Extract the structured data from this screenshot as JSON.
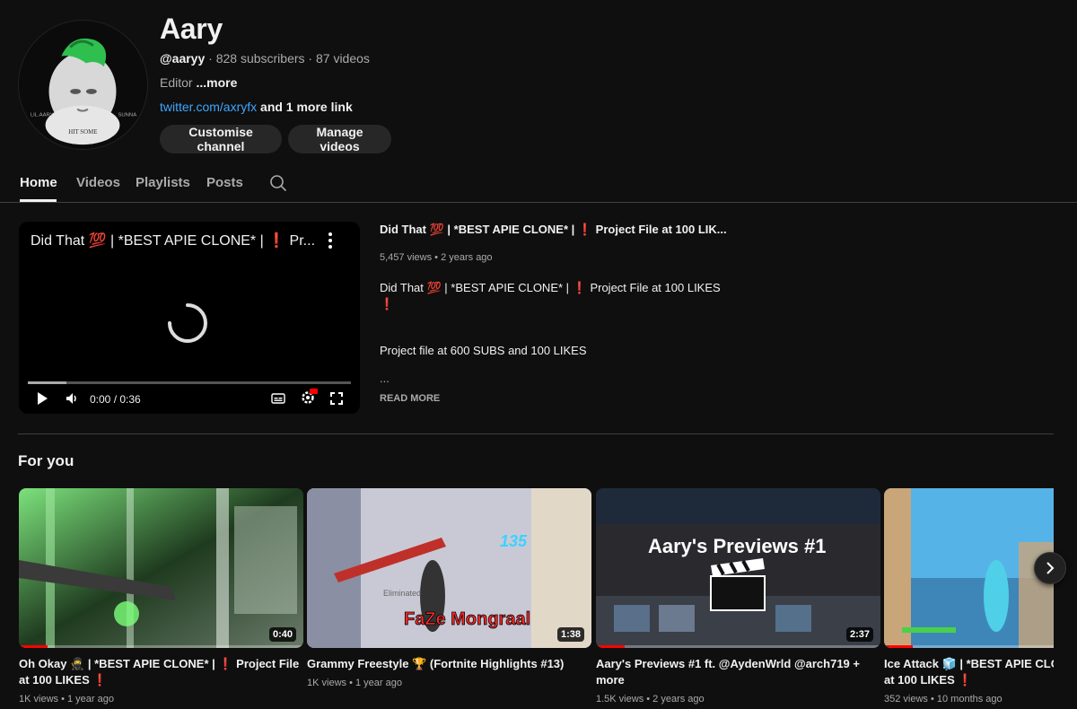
{
  "channel": {
    "name": "Aary",
    "handle": "@aaryy",
    "sep1": " · ",
    "subscribers": "828 subscribers",
    "sep2": " · ",
    "videos": "87 videos",
    "description": "Editor ",
    "more_label": "...more",
    "link_text": "twitter.com/axryfx",
    "more_links": " and 1 more link",
    "avatar_text_left": "LIL.AARY",
    "avatar_text_right": "SUNNA",
    "avatar_caption": "HIT SOME"
  },
  "buttons": {
    "customise": "Customise channel",
    "manage": "Manage videos"
  },
  "tabs": [
    "Home",
    "Videos",
    "Playlists",
    "Posts"
  ],
  "player": {
    "title": "Did That 💯 | *BEST APIE CLONE* | ❗ Pr...",
    "time": "0:00 / 0:36",
    "buffered_fraction": 0.12
  },
  "featured": {
    "title": "Did That 💯 | *BEST APIE CLONE* | ❗ Project File at 100 LIK...",
    "views": "5,457 views",
    "sep": " • ",
    "age": "2 years ago",
    "desc_line1": "Did That 💯 | *BEST APIE CLONE* | ❗ Project File at 100 LIKES",
    "desc_line1b": "❗",
    "desc_line2": "Project file at 600 SUBS and 100 LIKES",
    "ellipsis": "...",
    "read_more": "READ MORE"
  },
  "for_you": {
    "title": "For you",
    "videos": [
      {
        "title_a": "Oh Okay 🥷 | *BEST APIE CLONE* | ❗ Project File",
        "title_b": "at 100 LIKES ❗",
        "views": "1K views",
        "age": "1 year ago",
        "duration": "0:40",
        "progress": 0.1
      },
      {
        "title_a": "Grammy Freestyle 🏆 (Fortnite Highlights #13)",
        "title_b": "",
        "views": "1K views",
        "age": "1 year ago",
        "duration": "1:38",
        "progress": 0,
        "thumb_text1": "135",
        "thumb_text2": "FaZe Mongraal",
        "thumb_text3": "Eliminated"
      },
      {
        "title_a": "Aary's Previews #1 ft. @AydenWrld @arch719 +",
        "title_b": "more",
        "views": "1.5K views",
        "age": "2 years ago",
        "duration": "2:37",
        "progress": 0.1,
        "thumb_text": "Aary's Previews #1"
      },
      {
        "title_a": "Ice Attack 🧊 | *BEST APIE CLONE",
        "title_b": "at 100 LIKES ❗",
        "views": "352 views",
        "age": "10 months ago",
        "progress": 0.1
      }
    ]
  },
  "colors": {
    "background": "#0f0f0f",
    "link": "#3ea6ff",
    "accent_red": "#ff0000",
    "button_bg": "#272727"
  }
}
